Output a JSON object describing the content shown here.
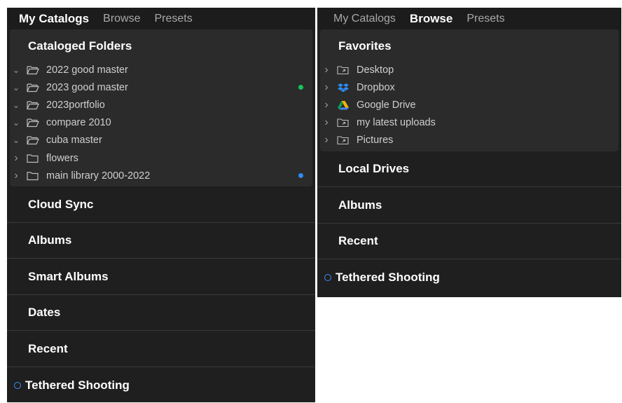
{
  "left": {
    "tabs": [
      "My Catalogs",
      "Browse",
      "Presets"
    ],
    "active_tab": "My Catalogs",
    "card_title": "Cataloged Folders",
    "folders": [
      {
        "label": "2022 good master",
        "expanded": true,
        "dot": ""
      },
      {
        "label": "2023 good master",
        "expanded": true,
        "dot": "#19c25a"
      },
      {
        "label": "2023portfolio",
        "expanded": true,
        "dot": ""
      },
      {
        "label": "compare 2010",
        "expanded": true,
        "dot": ""
      },
      {
        "label": "cuba master",
        "expanded": true,
        "dot": ""
      },
      {
        "label": "flowers",
        "expanded": false,
        "dot": ""
      },
      {
        "label": "main library 2000-2022",
        "expanded": false,
        "dot": "#2f8cf2"
      }
    ],
    "sections": [
      "Cloud Sync",
      "Albums",
      "Smart Albums",
      "Dates",
      "Recent"
    ],
    "tethered": "Tethered Shooting"
  },
  "right": {
    "tabs": [
      "My Catalogs",
      "Browse",
      "Presets"
    ],
    "active_tab": "Browse",
    "card_title": "Favorites",
    "favorites": [
      {
        "label": "Desktop",
        "icon": "folder-link-icon"
      },
      {
        "label": "Dropbox",
        "icon": "dropbox-icon"
      },
      {
        "label": "Google Drive",
        "icon": "google-drive-icon"
      },
      {
        "label": "my latest uploads",
        "icon": "folder-link-icon"
      },
      {
        "label": "Pictures",
        "icon": "folder-link-icon"
      }
    ],
    "sections": [
      "Local Drives",
      "Albums",
      "Recent"
    ],
    "tethered": "Tethered Shooting"
  },
  "colors": {
    "panel_bg": "#1f1f1f",
    "card_bg": "#2b2b2b",
    "green_dot": "#19c25a",
    "blue_dot": "#2f8cf2",
    "tether_ring": "#3a8ef5"
  }
}
